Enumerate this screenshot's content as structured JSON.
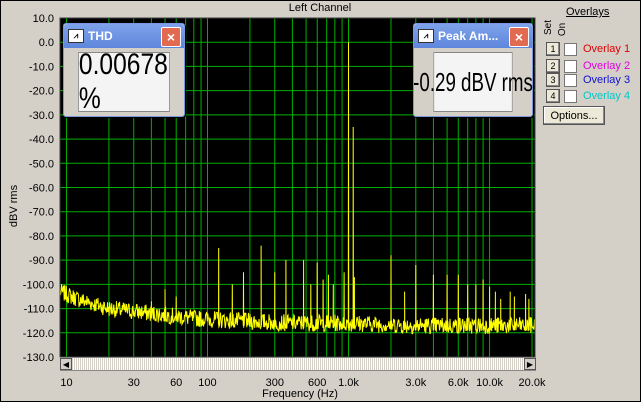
{
  "window": {
    "title": "Left Channel"
  },
  "meters": {
    "thd": {
      "title": "THD",
      "value": "0.00678 %",
      "close": "×"
    },
    "peak": {
      "title": "Peak Am...",
      "value": "-0.29 dBV rms",
      "close": "×"
    }
  },
  "overlays": {
    "title": "Overlays",
    "set_label": "Set",
    "on_label": "On",
    "items": [
      {
        "num": "1",
        "label": "Overlay 1",
        "color": "#e00000",
        "checked": false
      },
      {
        "num": "2",
        "label": "Overlay 2",
        "color": "#e000e0",
        "checked": false
      },
      {
        "num": "3",
        "label": "Overlay 3",
        "color": "#1010d0",
        "checked": false
      },
      {
        "num": "4",
        "label": "Overlay 4",
        "color": "#00c8c8",
        "checked": false
      }
    ],
    "options_label": "Options..."
  },
  "chart_data": {
    "type": "line",
    "title": "Left Channel",
    "xlabel": "Frequency (Hz)",
    "ylabel": "dBV rms",
    "x_scale": "log",
    "xlim": [
      9,
      21000
    ],
    "ylim": [
      -130,
      10
    ],
    "grid": true,
    "background": "#000000",
    "grid_color": "#00b000",
    "trace_color": "#ffff00",
    "y_ticks": [
      "10.0",
      "0.0",
      "-10.0",
      "-20.0",
      "-30.0",
      "-40.0",
      "-50.0",
      "-60.0",
      "-70.0",
      "-80.0",
      "-90.0",
      "-100.0",
      "-110.0",
      "-120.0",
      "-130.0"
    ],
    "x_ticks": [
      {
        "v": 10,
        "label": "10"
      },
      {
        "v": 30,
        "label": "30"
      },
      {
        "v": 60,
        "label": "60"
      },
      {
        "v": 100,
        "label": "100"
      },
      {
        "v": 300,
        "label": "300"
      },
      {
        "v": 600,
        "label": "600"
      },
      {
        "v": 1000,
        "label": "1.0k"
      },
      {
        "v": 3000,
        "label": "3.0k"
      },
      {
        "v": 6000,
        "label": "6.0k"
      },
      {
        "v": 10000,
        "label": "10.0k"
      },
      {
        "v": 20000,
        "label": "20.0k"
      }
    ],
    "series": [
      {
        "noise_floor": [
          [
            9,
            -103
          ],
          [
            12,
            -106
          ],
          [
            20,
            -110
          ],
          [
            40,
            -112
          ],
          [
            80,
            -114
          ],
          [
            150,
            -115
          ],
          [
            400,
            -116
          ],
          [
            1000,
            -116
          ],
          [
            3000,
            -117
          ],
          [
            10000,
            -117
          ],
          [
            21000,
            -117
          ]
        ],
        "spikes": [
          [
            1000,
            0
          ],
          [
            1080,
            -35
          ],
          [
            930,
            -95
          ],
          [
            1100,
            -97
          ],
          [
            120,
            -85
          ],
          [
            180,
            -95
          ],
          [
            240,
            -84
          ],
          [
            300,
            -95
          ],
          [
            360,
            -90
          ],
          [
            480,
            -90
          ],
          [
            540,
            -100
          ],
          [
            600,
            -91
          ],
          [
            660,
            -98
          ],
          [
            720,
            -96
          ],
          [
            780,
            -100
          ],
          [
            50,
            -102
          ],
          [
            60,
            -105
          ],
          [
            40,
            -107
          ],
          [
            150,
            -100
          ],
          [
            2000,
            -88
          ],
          [
            2500,
            -103
          ],
          [
            3000,
            -92
          ],
          [
            4000,
            -96
          ],
          [
            5000,
            -96
          ],
          [
            6000,
            -96
          ],
          [
            7000,
            -100
          ],
          [
            8000,
            -100
          ],
          [
            9000,
            -98
          ],
          [
            10000,
            -101
          ],
          [
            11000,
            -103
          ],
          [
            12000,
            -106
          ],
          [
            14000,
            -103
          ],
          [
            15000,
            -105
          ],
          [
            18000,
            -104
          ],
          [
            19000,
            -106
          ]
        ]
      }
    ]
  }
}
